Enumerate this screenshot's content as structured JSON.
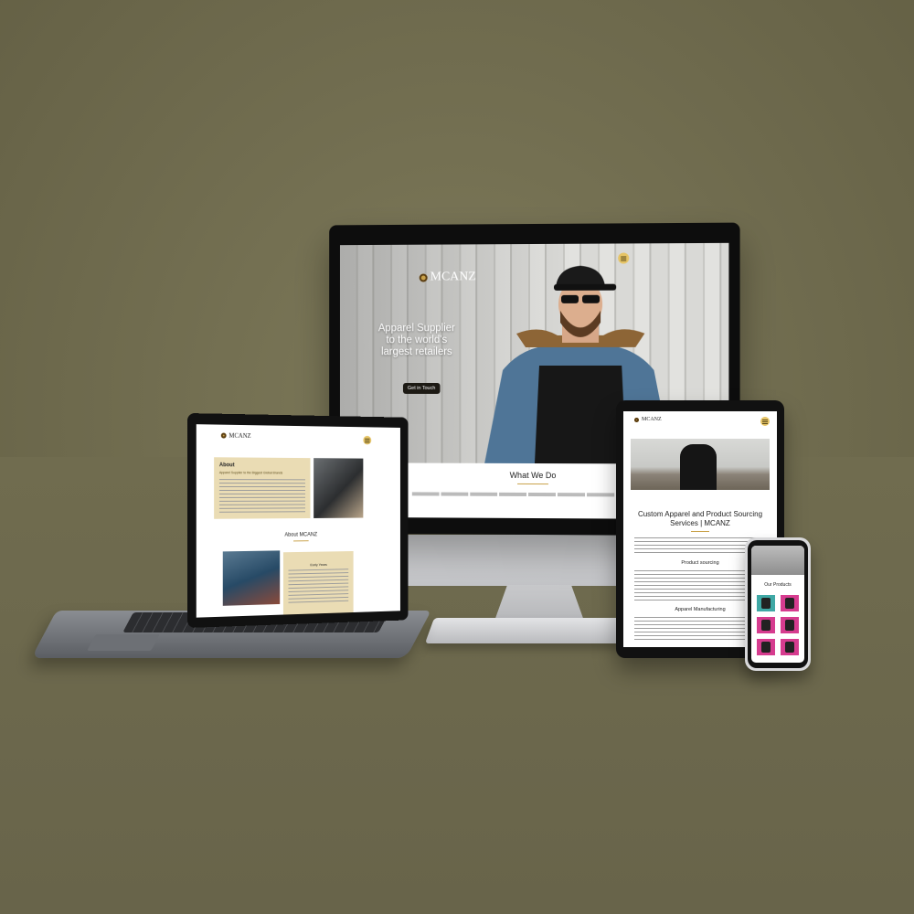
{
  "imac": {
    "logo": "MCANZ",
    "hero_heading_line1": "Apparel Supplier",
    "hero_heading_line2": "to the world's",
    "hero_heading_line3": "largest retailers",
    "cta_label": "Get in Touch",
    "section_title": "What We Do"
  },
  "laptop": {
    "logo": "MCANZ",
    "about_title": "About",
    "about_subtitle": "Apparel Supplier to the Biggest Global Brands",
    "about_section_title": "About MCANZ",
    "card_title": "Early Years"
  },
  "tablet": {
    "logo": "MCANZ",
    "heading_line1": "Custom Apparel and Product Sourcing",
    "heading_line2": "Services | MCANZ",
    "section1": "Product sourcing",
    "section2": "Apparel Manufacturing"
  },
  "phone": {
    "section_title": "Our Products"
  },
  "colors": {
    "background": "#6f6b4e",
    "accent_gold": "#e6c466",
    "card_beige": "#eadcb4",
    "product_pink": "#d63c8f",
    "product_teal": "#3fa8a5"
  }
}
